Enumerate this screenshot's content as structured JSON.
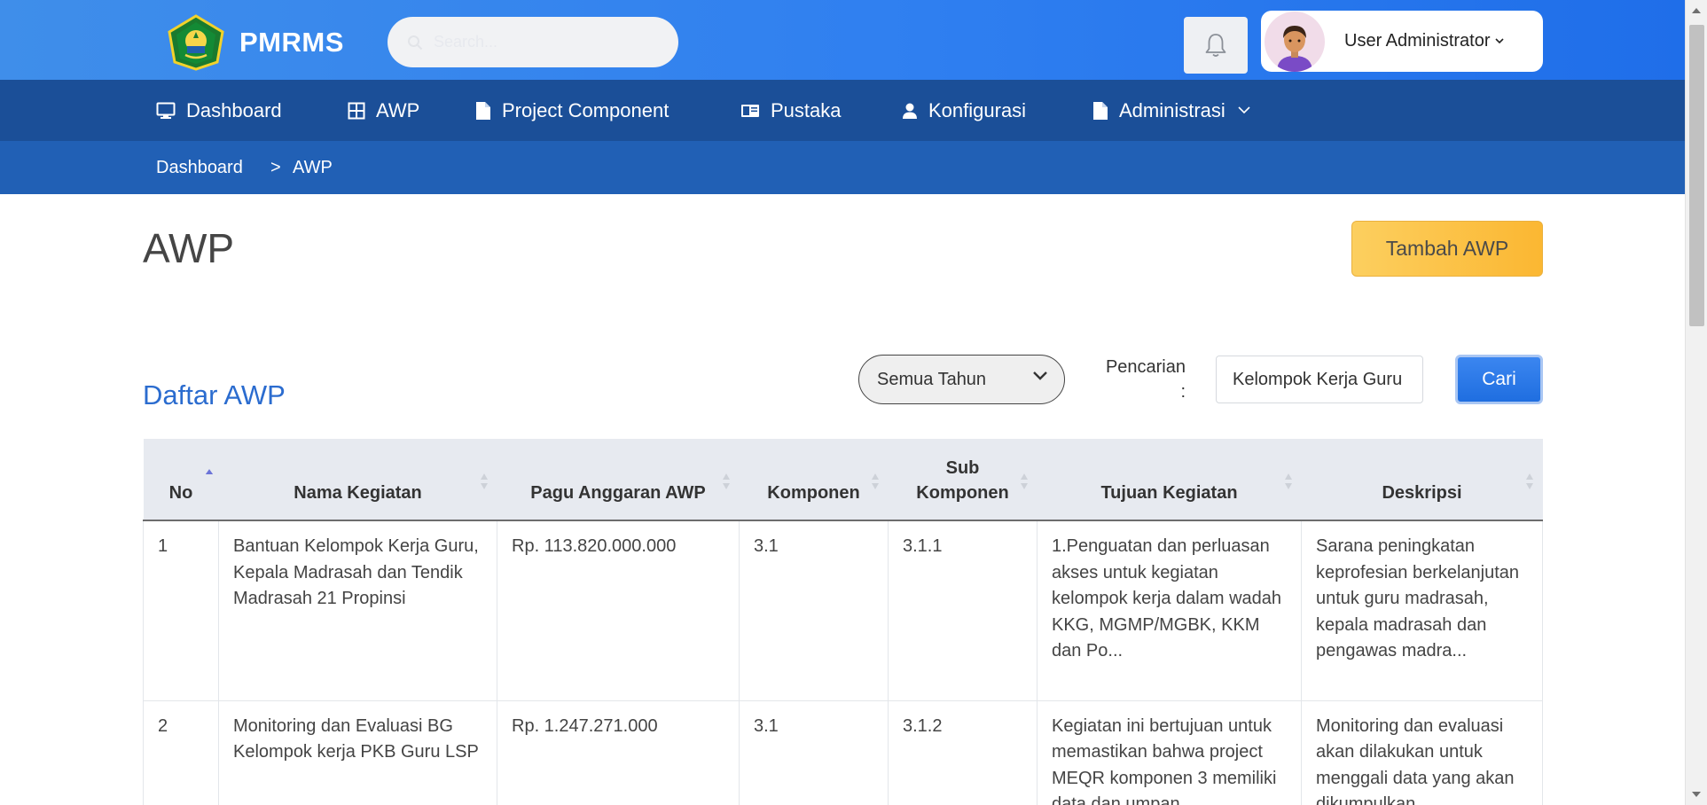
{
  "header": {
    "brand": "PMRMS",
    "search_placeholder": "Search...",
    "user_name": "User Administrator"
  },
  "nav": {
    "items": [
      {
        "label": "Dashboard",
        "icon": "monitor-icon"
      },
      {
        "label": "AWP",
        "icon": "grid-icon"
      },
      {
        "label": "Project Component",
        "icon": "document-icon"
      },
      {
        "label": "Pustaka",
        "icon": "book-icon"
      },
      {
        "label": "Konfigurasi",
        "icon": "user-icon"
      },
      {
        "label": "Administrasi",
        "icon": "document-icon"
      }
    ]
  },
  "breadcrumb": {
    "home": "Dashboard",
    "separator": ">",
    "current": "AWP"
  },
  "page": {
    "title": "AWP",
    "add_button": "Tambah AWP",
    "section_title": "Daftar AWP"
  },
  "filters": {
    "year_selected": "Semua Tahun",
    "search_label_1": "Pencarian",
    "search_label_2": ":",
    "search_value": "Kelompok Kerja Guru",
    "search_button": "Cari"
  },
  "table": {
    "columns": [
      {
        "label": "No"
      },
      {
        "label": "Nama Kegiatan"
      },
      {
        "label": "Pagu Anggaran AWP"
      },
      {
        "label": "Komponen"
      },
      {
        "label": "Sub Komponen"
      },
      {
        "label": "Tujuan Kegiatan"
      },
      {
        "label": "Deskripsi"
      }
    ],
    "rows": [
      {
        "no": "1",
        "nama": "Bantuan Kelompok Kerja Guru, Kepala Madrasah dan Tendik Madrasah 21 Propinsi",
        "pagu": "Rp. 113.820.000.000",
        "komponen": "3.1",
        "sub_komponen": "3.1.1",
        "tujuan": "1.Penguatan dan perluasan akses untuk kegiatan kelompok kerja dalam wadah KKG, MGMP/MGBK, KKM dan Po...",
        "deskripsi": "Sarana peningkatan keprofesian berkelanjutan untuk guru madrasah, kepala madrasah dan pengawas madra..."
      },
      {
        "no": "2",
        "nama": "Monitoring dan Evaluasi BG Kelompok kerja PKB Guru LSP",
        "pagu": "Rp. 1.247.271.000",
        "komponen": "3.1",
        "sub_komponen": "3.1.2",
        "tujuan": "Kegiatan ini bertujuan untuk memastikan bahwa project MEQR komponen 3 memiliki data dan umpan",
        "deskripsi": "Monitoring dan evaluasi akan dilakukan untuk menggali data yang akan dikumpulkan"
      }
    ]
  },
  "colors": {
    "header_gradient_start": "#3f8eea",
    "nav_bg": "#1b4f98",
    "breadcrumb_bg": "#2160b5",
    "accent_blue": "#2b6ccf",
    "add_button": "#fbb732"
  }
}
